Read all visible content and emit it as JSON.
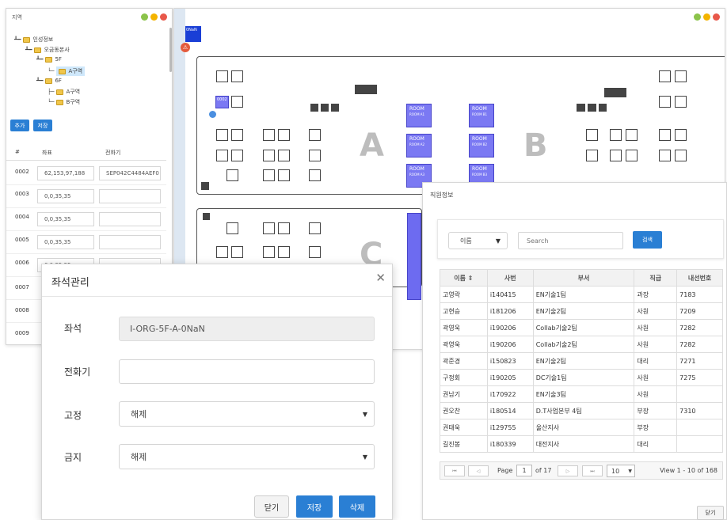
{
  "tree_window": {
    "title": "지역",
    "tree": [
      {
        "label": "인성정보"
      },
      {
        "label": "오금동본사"
      },
      {
        "label": "5F"
      },
      {
        "label": "A구역"
      },
      {
        "label": "6F"
      },
      {
        "label": "A구역"
      },
      {
        "label": "B구역"
      }
    ],
    "add_label": "추가",
    "save_label": "저장",
    "columns": [
      "#",
      "좌표",
      "전화기"
    ],
    "rows": [
      {
        "no": "0002",
        "coord": "62,153,97,188",
        "phone": "SEP042C4484AEF0"
      },
      {
        "no": "0003",
        "coord": "0,0,35,35",
        "phone": ""
      },
      {
        "no": "0004",
        "coord": "0,0,35,35",
        "phone": ""
      },
      {
        "no": "0005",
        "coord": "0,0,35,35",
        "phone": ""
      },
      {
        "no": "0006",
        "coord": "0,0,35,35",
        "phone": ""
      },
      {
        "no": "0007",
        "coord": "",
        "phone": ""
      },
      {
        "no": "0008",
        "coord": "",
        "phone": ""
      },
      {
        "no": "0009",
        "coord": "",
        "phone": ""
      }
    ]
  },
  "floorplan": {
    "marker_label": "0NaN",
    "seat_label": "0002",
    "zones": [
      "A",
      "B",
      "C"
    ],
    "rooms": [
      {
        "name": "ROOM",
        "sub": "ROOM A1"
      },
      {
        "name": "ROOM",
        "sub": "ROOM A2"
      },
      {
        "name": "ROOM",
        "sub": "ROOM A3"
      },
      {
        "name": "ROOM",
        "sub": "ROOM B1"
      },
      {
        "name": "ROOM",
        "sub": "ROOM B2"
      },
      {
        "name": "ROOM",
        "sub": "ROOM B3"
      }
    ]
  },
  "seat_dialog": {
    "title": "좌석관리",
    "seat_label": "좌석",
    "seat_value": "I-ORG-5F-A-0NaN",
    "phone_label": "전화기",
    "phone_value": "",
    "fixed_label": "고정",
    "fixed_value": "해제",
    "ban_label": "금지",
    "ban_value": "해제",
    "close_label": "닫기",
    "save_label": "저장",
    "delete_label": "삭제"
  },
  "employee_dialog": {
    "title": "직원정보",
    "filter_value": "이름",
    "search_placeholder": "Search",
    "search_button": "검색",
    "columns": [
      "이름 ⇕",
      "사번",
      "부서",
      "직급",
      "내선번호"
    ],
    "rows": [
      [
        "고영락",
        "i140415",
        "EN기술1팀",
        "과장",
        "7183"
      ],
      [
        "고현승",
        "i181206",
        "EN기술2팀",
        "사원",
        "7209"
      ],
      [
        "곽영욱",
        "i190206",
        "Collab기술2팀",
        "사원",
        "7282"
      ],
      [
        "곽영욱",
        "i190206",
        "Collab기술2팀",
        "사원",
        "7282"
      ],
      [
        "곽준경",
        "i150823",
        "EN기술2팀",
        "대리",
        "7271"
      ],
      [
        "구정회",
        "i190205",
        "DC기술1팀",
        "사원",
        "7275"
      ],
      [
        "권남기",
        "i170922",
        "EN기술3팀",
        "사원",
        ""
      ],
      [
        "권오찬",
        "i180514",
        "D.T사업본부 4팀",
        "부장",
        "7310"
      ],
      [
        "권태욱",
        "i129755",
        "울산지사",
        "부장",
        ""
      ],
      [
        "길진봉",
        "i180339",
        "대전지사",
        "대리",
        ""
      ]
    ],
    "pager": {
      "page_label": "Page",
      "page_value": "1",
      "of_label": "of 17",
      "page_size": "10",
      "view_text": "View 1 - 10 of 168"
    },
    "close_label": "닫기"
  },
  "colors": {
    "accent": "#2a7fd4",
    "room": "#7b79f3",
    "dot_green": "#8bc34a",
    "dot_yellow": "#f4b400",
    "dot_red": "#e8584a"
  }
}
